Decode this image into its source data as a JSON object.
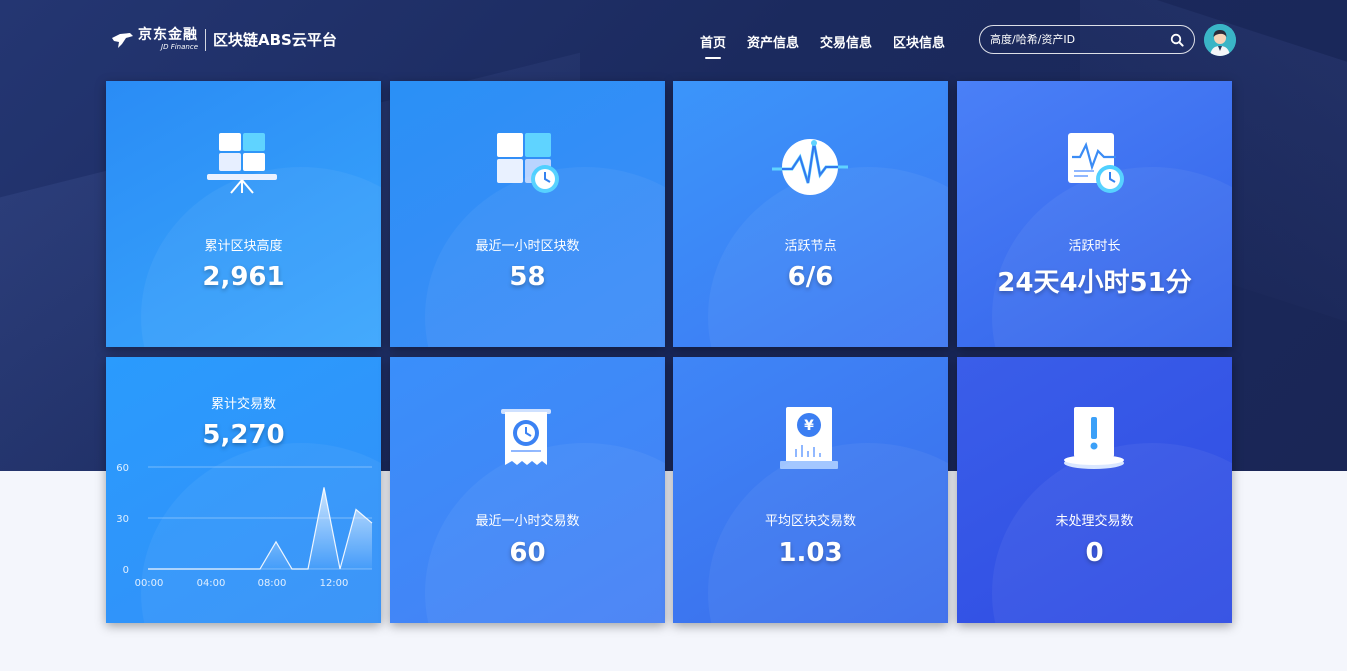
{
  "header": {
    "logo_cn": "京东金融",
    "logo_en": "JD Finance",
    "platform": "区块链ABS云平台",
    "nav": [
      {
        "label": "首页",
        "active": true
      },
      {
        "label": "资产信息",
        "active": false
      },
      {
        "label": "交易信息",
        "active": false
      },
      {
        "label": "区块信息",
        "active": false
      }
    ],
    "search_placeholder": "高度/哈希/资产ID",
    "search_icon": "search-icon",
    "avatar_icon": "avatar-icon"
  },
  "stats_top": [
    {
      "label": "累计区块高度",
      "value": "2,961",
      "icon": "block-board-icon"
    },
    {
      "label": "最近一小时区块数",
      "value": "58",
      "icon": "block-clock-icon"
    },
    {
      "label": "活跃节点",
      "value": "6/6",
      "icon": "pulse-node-icon"
    },
    {
      "label": "活跃时长",
      "value": "24天4小时51分",
      "icon": "chart-clock-icon"
    }
  ],
  "stats_bottom": [
    {
      "label": "累计交易数",
      "value": "5,270",
      "icon": "line-chart"
    },
    {
      "label": "最近一小时交易数",
      "value": "60",
      "icon": "receipt-clock-icon"
    },
    {
      "label": "平均区块交易数",
      "value": "1.03",
      "icon": "yuan-doc-icon"
    },
    {
      "label": "未处理交易数",
      "value": "0",
      "icon": "alert-doc-icon"
    }
  ],
  "colors": {
    "hero_bg": "#1f2f66",
    "page_bg": "#f4f6fc",
    "card_blue": "#3390f8",
    "card_indigo": "#2f4ce3"
  },
  "chart_data": {
    "type": "area",
    "x": [
      "00:00",
      "01:00",
      "02:00",
      "03:00",
      "04:00",
      "05:00",
      "06:00",
      "07:00",
      "08:00",
      "09:00",
      "10:00",
      "11:00",
      "12:00",
      "13:00"
    ],
    "values": [
      0,
      0,
      0,
      0,
      0,
      0,
      0,
      0,
      16,
      0,
      0,
      48,
      0,
      35,
      27
    ],
    "x_tick_labels": [
      "00:00",
      "04:00",
      "08:00",
      "12:00"
    ],
    "y_tick_labels": [
      "60",
      "30",
      "0"
    ],
    "ylim": [
      0,
      60
    ],
    "grid": true
  }
}
